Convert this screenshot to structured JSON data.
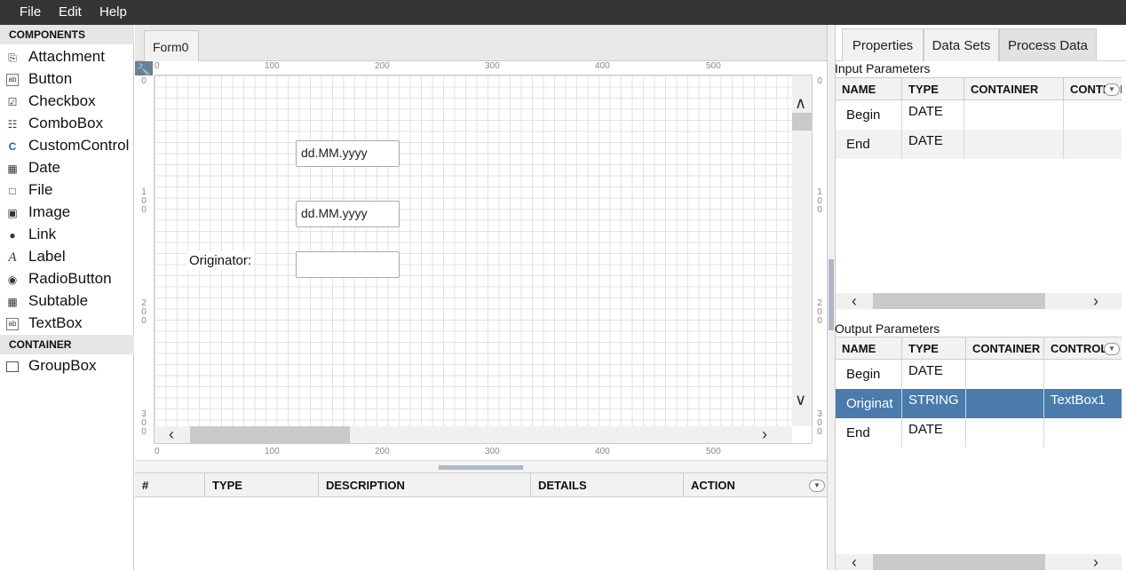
{
  "menubar": {
    "items": [
      "File",
      "Edit",
      "Help"
    ]
  },
  "components": {
    "header": "COMPONENTS",
    "items": [
      {
        "label": "Attachment",
        "icon": "paperclip-icon",
        "glyph": "⎘"
      },
      {
        "label": "Button",
        "icon": "button-icon",
        "glyph": "ab"
      },
      {
        "label": "Checkbox",
        "icon": "checkbox-icon",
        "glyph": "☑"
      },
      {
        "label": "ComboBox",
        "icon": "combobox-icon",
        "glyph": "☷"
      },
      {
        "label": "CustomControl",
        "icon": "custom-control-icon",
        "glyph": "C"
      },
      {
        "label": "Date",
        "icon": "calendar-icon",
        "glyph": "▦"
      },
      {
        "label": "File",
        "icon": "file-icon",
        "glyph": "□"
      },
      {
        "label": "Image",
        "icon": "image-icon",
        "glyph": "▣"
      },
      {
        "label": "Link",
        "icon": "globe-link-icon",
        "glyph": "●"
      },
      {
        "label": "Label",
        "icon": "label-icon",
        "glyph": "A"
      },
      {
        "label": "RadioButton",
        "icon": "radio-icon",
        "glyph": "◉"
      },
      {
        "label": "Subtable",
        "icon": "table-icon",
        "glyph": "▦"
      },
      {
        "label": "TextBox",
        "icon": "textbox-icon",
        "glyph": "ab"
      }
    ],
    "container_header": "CONTAINER",
    "container_items": [
      {
        "label": "GroupBox",
        "icon": "groupbox-icon",
        "glyph": "▭"
      }
    ]
  },
  "canvas": {
    "tab_label": "Form0",
    "ruler_h": [
      "0",
      "100",
      "200",
      "300",
      "400",
      "500"
    ],
    "ruler_v_left": [
      "0",
      "1\n0\n0",
      "2\n0\n0",
      "3\n0\n0"
    ],
    "ruler_v_right": [
      "0",
      "1\n0\n0",
      "2\n0\n0",
      "3\n0\n0"
    ],
    "fields": [
      {
        "value": "dd.MM.yyyy"
      },
      {
        "value": "dd.MM.yyyy"
      },
      {
        "value": ""
      }
    ],
    "originator_label": "Originator:"
  },
  "bottom_table": {
    "columns": [
      "#",
      "TYPE",
      "DESCRIPTION",
      "DETAILS",
      "ACTION"
    ]
  },
  "right_panel": {
    "tabs": [
      "Properties",
      "Data Sets",
      "Process Data"
    ],
    "active_tab": "Process Data",
    "input": {
      "title": "Input Parameters",
      "columns": [
        "NAME",
        "TYPE",
        "CONTAINER",
        "CONTROL"
      ],
      "rows": [
        {
          "name": "Begin",
          "type": "DATE",
          "container": "",
          "control": ""
        },
        {
          "name": "End",
          "type": "DATE",
          "container": "",
          "control": ""
        }
      ]
    },
    "output": {
      "title": "Output Parameters",
      "columns": [
        "NAME",
        "TYPE",
        "CONTAINER",
        "CONTROL"
      ],
      "rows": [
        {
          "name": "Begin",
          "type": "DATE",
          "container": "",
          "control": ""
        },
        {
          "name": "Originat",
          "type": "STRING",
          "container": "",
          "control": "TextBox1"
        },
        {
          "name": "End",
          "type": "DATE",
          "container": "",
          "control": ""
        }
      ],
      "selected_row": 1
    }
  },
  "colors": {
    "menubar_bg": "#353535",
    "selected_row": "#4a7bab",
    "custom_control_icon": "#2a55d0"
  }
}
